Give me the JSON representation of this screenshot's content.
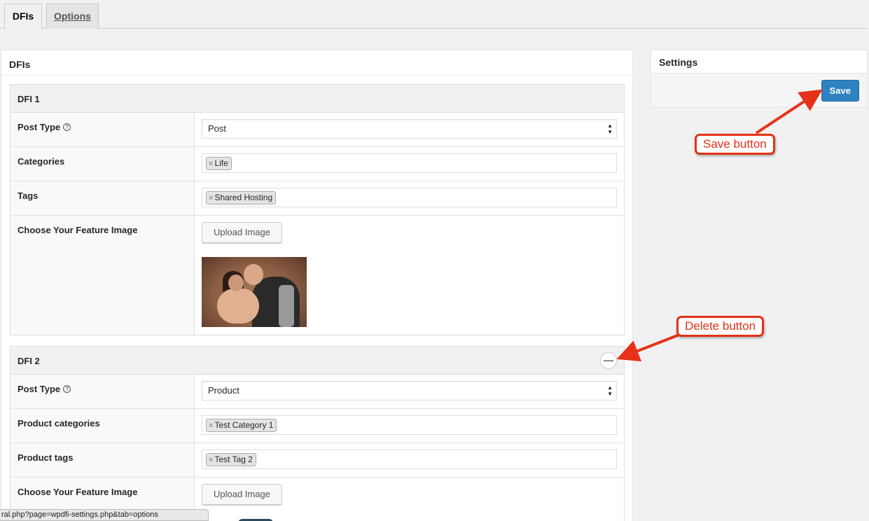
{
  "tabs": [
    {
      "label": "DFIs",
      "active": true
    },
    {
      "label": "Options",
      "active": false
    }
  ],
  "panel": {
    "title": "DFIs"
  },
  "dfi1": {
    "title": "DFI 1",
    "post_type_label": "Post Type",
    "post_type_value": "Post",
    "categories_label": "Categories",
    "categories": [
      "Life"
    ],
    "tags_label": "Tags",
    "tags": [
      "Shared Hosting"
    ],
    "image_label": "Choose Your Feature Image",
    "upload_label": "Upload Image"
  },
  "dfi2": {
    "title": "DFI 2",
    "post_type_label": "Post Type",
    "post_type_value": "Product",
    "categories_label": "Product categories",
    "categories": [
      "Test Category 1"
    ],
    "tags_label": "Product tags",
    "tags": [
      "Test Tag 2"
    ],
    "image_label": "Choose Your Feature Image",
    "upload_label": "Upload Image",
    "delete_symbol": "—"
  },
  "settings": {
    "title": "Settings",
    "save_label": "Save"
  },
  "annotations": {
    "save": "Save button",
    "delete": "Delete button",
    "color": "#e53219"
  },
  "chip_remove": "×",
  "help_symbol": "?",
  "select_arrows": "▲▼",
  "status_url": "ral.php?page=wpdfi-settings.php&tab=options",
  "colors": {
    "primary_button": "#2e82c0",
    "annotation": "#e53219",
    "background": "#f1f1f1"
  }
}
